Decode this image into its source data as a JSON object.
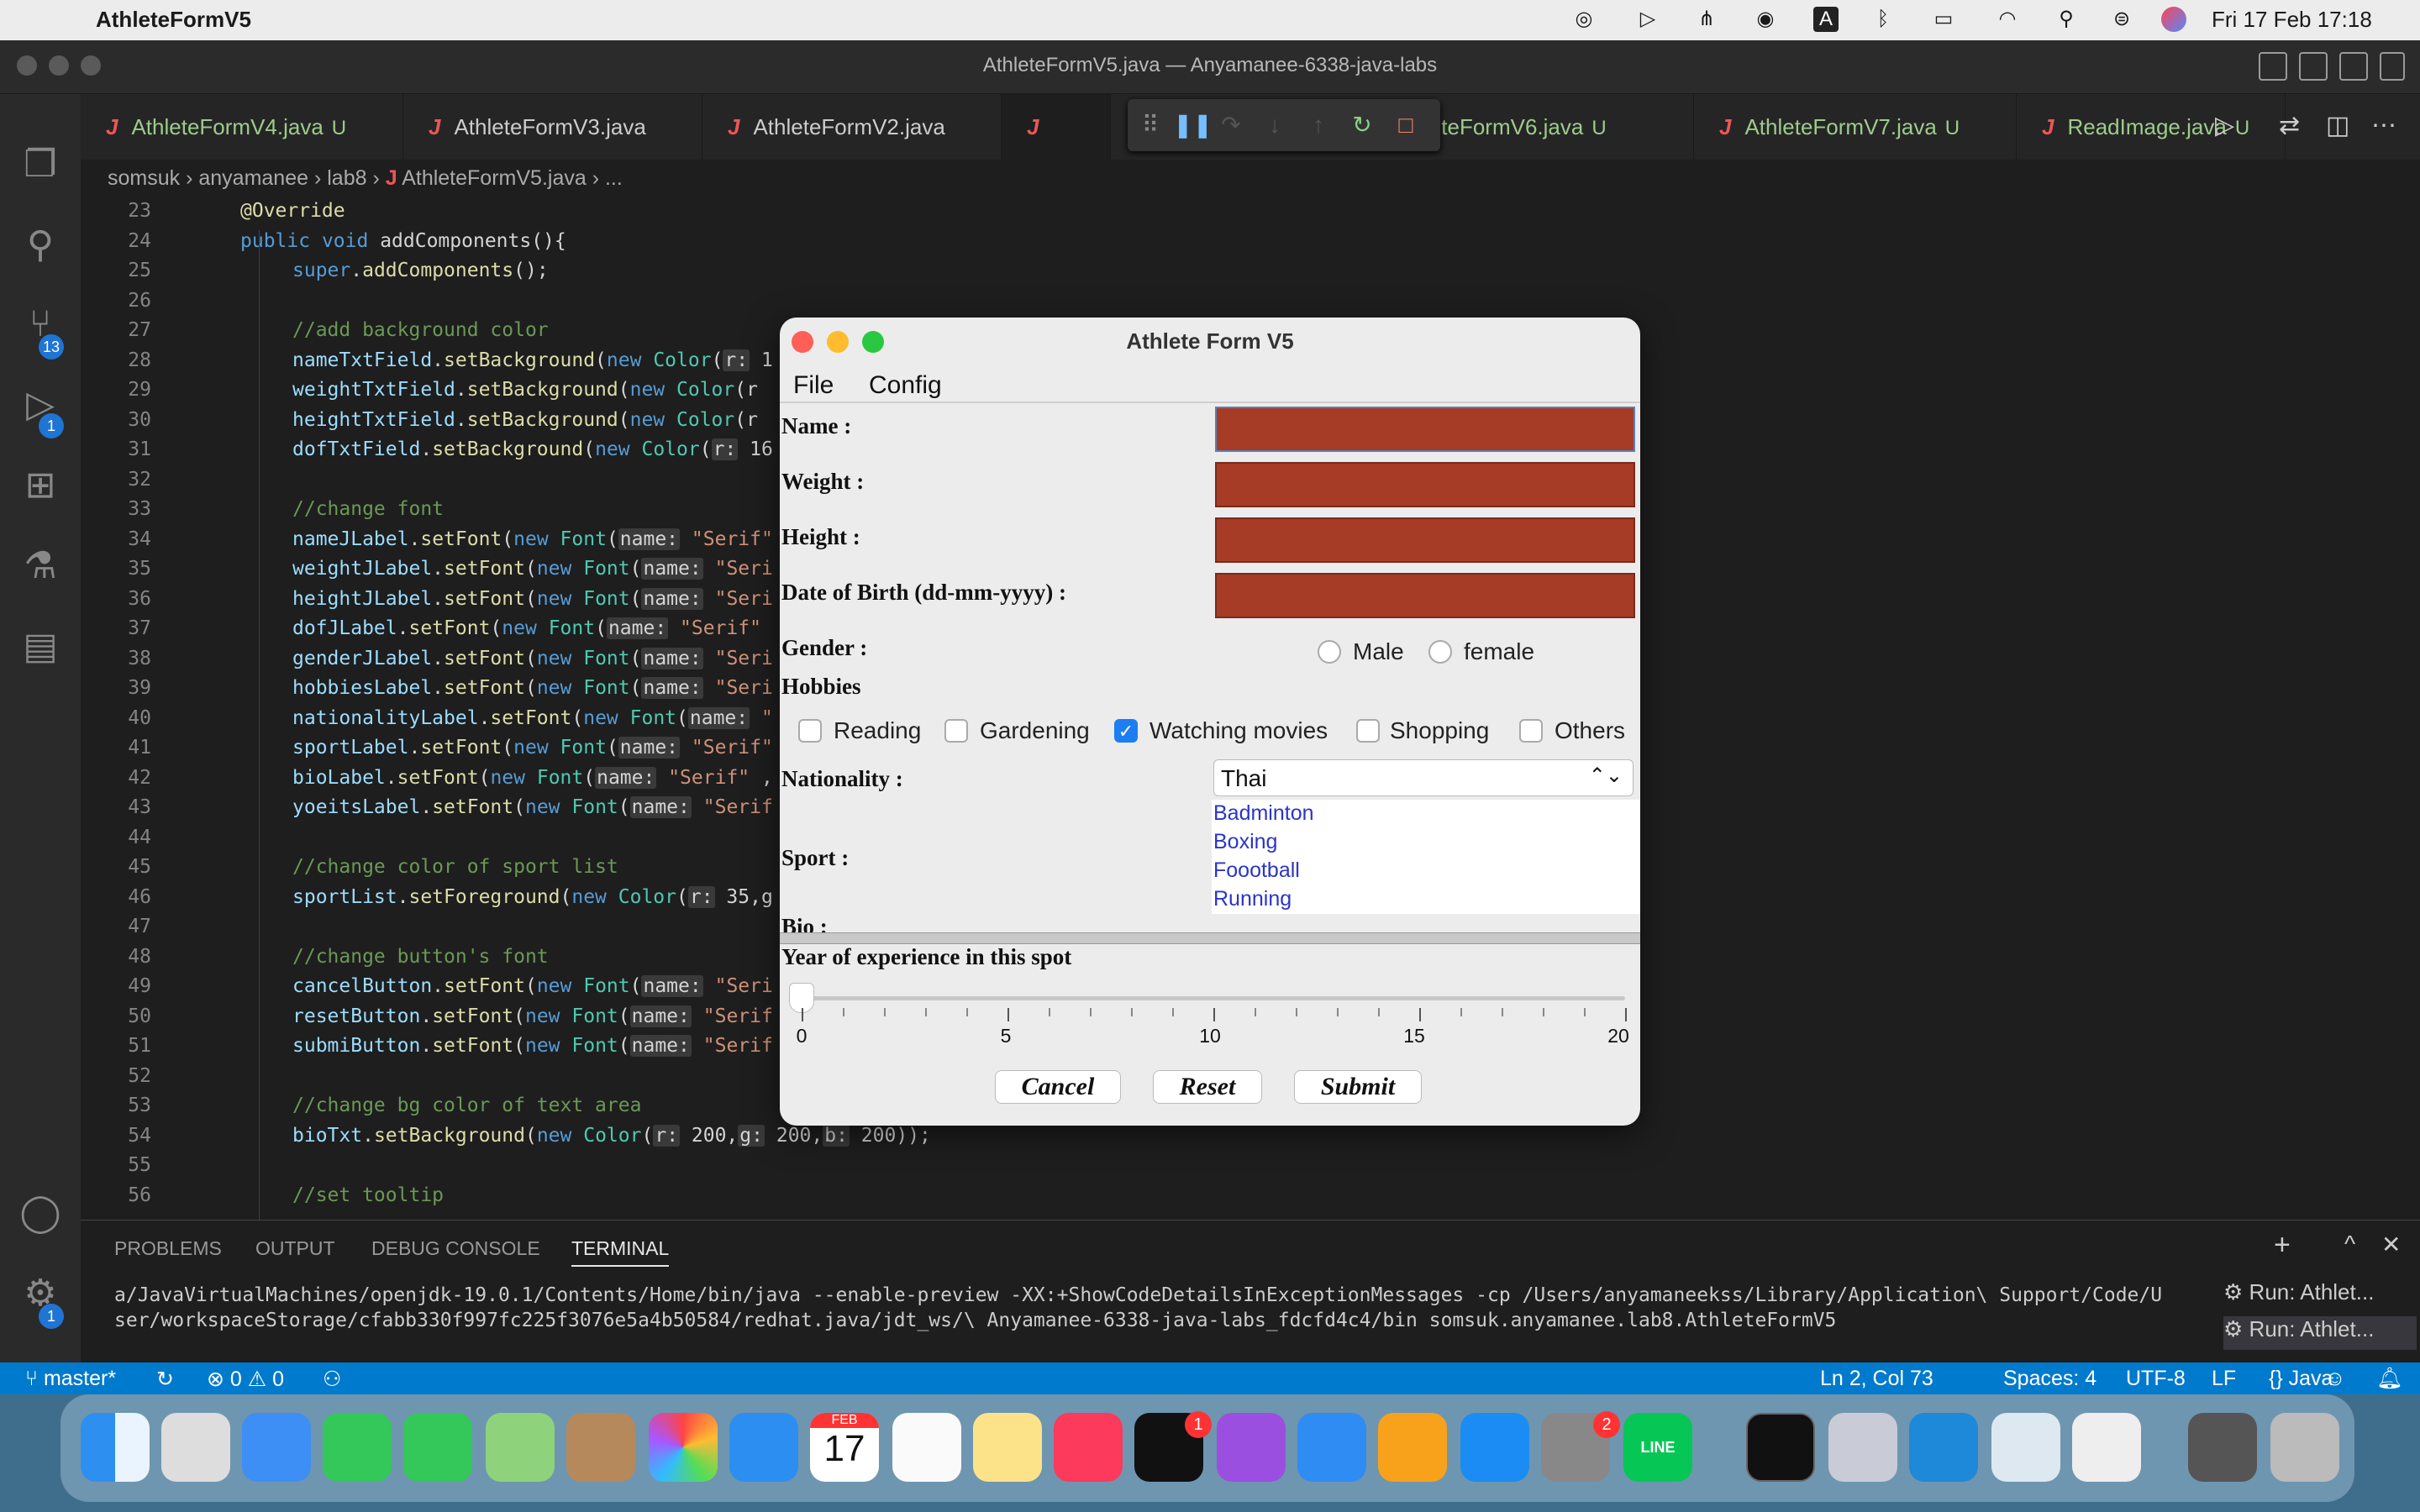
{
  "menubar": {
    "app_name": "AthleteFormV5",
    "date_time": "Fri 17 Feb  17:18"
  },
  "vscode": {
    "window_title": "AthleteFormV5.java — Anyamanee-6338-java-labs",
    "tabs": [
      {
        "name": "AthleteFormV4.java",
        "status": "U"
      },
      {
        "name": "AthleteFormV3.java",
        "status": ""
      },
      {
        "name": "AthleteFormV2.java",
        "status": ""
      },
      {
        "name": "AthleteFormV6.java",
        "status": "U"
      },
      {
        "name": "AthleteFormV7.java",
        "status": "U"
      },
      {
        "name": "ReadImage.java",
        "status": "U"
      }
    ],
    "breadcrumb": [
      "somsuk",
      "anyamanee",
      "lab8",
      "AthleteFormV5.java",
      "..."
    ],
    "badges": {
      "source_control": "13",
      "debug": "1",
      "settings": "1"
    }
  },
  "editor": {
    "line_numbers": [
      "23",
      "24",
      "25",
      "26",
      "27",
      "28",
      "29",
      "30",
      "31",
      "32",
      "33",
      "34",
      "35",
      "36",
      "37",
      "38",
      "39",
      "40",
      "41",
      "42",
      "43",
      "44",
      "45",
      "46",
      "47",
      "48",
      "49",
      "50",
      "51",
      "52",
      "53",
      "54",
      "55",
      "56"
    ]
  },
  "panel": {
    "tabs": [
      "PROBLEMS",
      "OUTPUT",
      "DEBUG CONSOLE",
      "TERMINAL"
    ],
    "terminal_line1": "a/JavaVirtualMachines/openjdk-19.0.1/Contents/Home/bin/java --enable-preview -XX:+ShowCodeDetailsInExceptionMessages -cp /Users/anyamaneekss/Library/Application\\ Support/Code/U",
    "terminal_line2": "ser/workspaceStorage/cfabb330f997fc225f3076e5a4b50584/redhat.java/jdt_ws/\\ Anyamanee-6338-java-labs_fdcfd4c4/bin somsuk.anyamanee.lab8.AthleteFormV5",
    "run_items": [
      "Run: Athlet...",
      "Run: Athlet..."
    ]
  },
  "statusbar": {
    "branch": "master*",
    "problems": "0",
    "warnings": "0",
    "position": "Ln 2, Col 73",
    "spaces": "Spaces: 4",
    "encoding": "UTF-8",
    "eol": "LF",
    "language": "Java"
  },
  "dock": {
    "calendar_month": "FEB",
    "calendar_day": "17",
    "tv_badge": "1",
    "settings_badge": "2",
    "line_label": "LINE"
  },
  "dialog": {
    "title": "Athlete Form V5",
    "menu": [
      "File",
      "Config"
    ],
    "labels": {
      "name": "Name :",
      "weight": "Weight :",
      "height": "Height :",
      "dob": "Date of Birth (dd-mm-yyyy) :",
      "gender": "Gender :",
      "hobbies": "Hobbies",
      "nationality": "Nationality :",
      "sport": "Sport :",
      "bio": "Bio :",
      "experience": "Year of experience in this spot"
    },
    "gender_options": [
      "Male",
      "female"
    ],
    "hobbies": [
      {
        "label": "Reading",
        "checked": false
      },
      {
        "label": "Gardening",
        "checked": false
      },
      {
        "label": "Watching movies",
        "checked": true
      },
      {
        "label": "Shopping",
        "checked": false
      },
      {
        "label": "Others",
        "checked": false
      }
    ],
    "nationality_value": "Thai",
    "sports": [
      "Badminton",
      "Boxing",
      "Foootball",
      "Running"
    ],
    "slider": {
      "min": 0,
      "max": 20,
      "value": 0,
      "labels": [
        "0",
        "5",
        "10",
        "15",
        "20"
      ]
    },
    "buttons": {
      "cancel": "Cancel",
      "reset": "Reset",
      "submit": "Submit"
    },
    "field_color": "#a63b26"
  },
  "code_lines": [
    "@Override",
    "public void addComponents(){",
    "super.addComponents();",
    "",
    "//add background color",
    "nameTxtField.setBackground(new Color(r: 1",
    "weightTxtField.setBackground(new Color(r",
    "heightTxtField.setBackground(new Color(r",
    "dofTxtField.setBackground(new Color(r: 16",
    "",
    "//change font",
    "nameJLabel.setFont(new Font(name: \"Serif\"",
    "weightJLabel.setFont(new Font(name: \"Seri",
    "heightJLabel.setFont(new Font(name: \"Seri",
    "dofJLabel.setFont(new Font(name: \"Serif\"",
    "genderJLabel.setFont(new Font(name: \"Seri",
    "hobbiesLabel.setFont(new Font(name: \"Seri",
    "nationalityLabel.setFont(new Font(name: \"",
    "sportLabel.setFont(new Font(name: \"Serif\"",
    "bioLabel.setFont(new Font(name: \"Serif\" ,",
    "yoeitsLabel.setFont(new Font(name: \"Serif",
    "",
    "//change color of sport list",
    "sportList.setForeground(new Color(r: 35,g",
    "",
    "//change button's font",
    "cancelButton.setFont(new Font(name: \"Seri",
    "resetButton.setFont(new Font(name: \"Serif",
    "submiButton.setFont(new Font(name: \"Serif",
    "",
    "//change bg color of text area",
    "bioTxt.setBackground(new Color(r: 200,g: 200,b: 200));",
    "",
    "//set tooltip"
  ]
}
